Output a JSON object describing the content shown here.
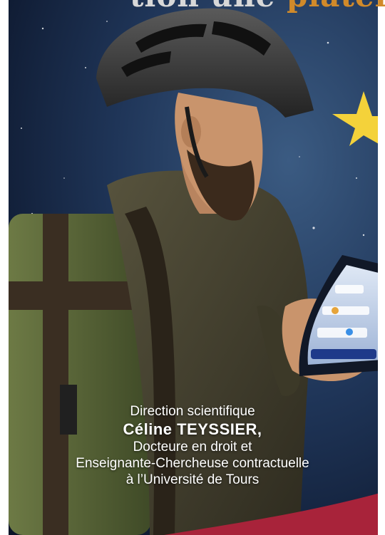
{
  "cover": {
    "title_fragment_prefix": "tion une ",
    "title_fragment_highlight": "plateforme",
    "credits": {
      "role": "Direction scientifique",
      "name": "Céline TEYSSIER,",
      "degree": "Docteure en droit et",
      "position": "Enseignante-Chercheuse contractuelle",
      "affiliation": "à l’Université de Tours"
    }
  },
  "colors": {
    "sky_dark": "#0d1a33",
    "sky_light": "#2f4e72",
    "star": "#f7d93a",
    "helmet": "#3a3a3a",
    "jacket": "#4a4632",
    "backpack": "#5e6b3c",
    "accent_band": "#a8233a",
    "title_highlight": "#d18a2a"
  }
}
